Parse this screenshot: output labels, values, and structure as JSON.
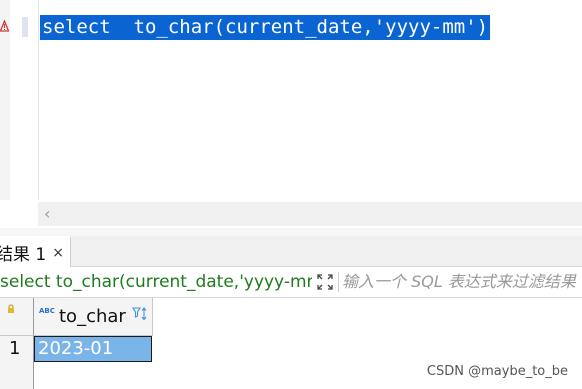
{
  "editor": {
    "code": "select  to_char(current_date,'yyyy-mm')",
    "warning_icon": "warning-triangle-icon",
    "hscroll_icon": "chevron-left-icon"
  },
  "results": {
    "tab_label": "结果 1",
    "tab_close": "×",
    "query_text": "select to_char(current_date,'yyyy-mm')",
    "filter_placeholder": "输入一个 SQL 表达式来过滤结果",
    "columns": [
      {
        "name": "to_char",
        "type_badge": "ABC"
      }
    ],
    "rows": [
      {
        "row_number": "1",
        "cells": [
          "2023-01"
        ]
      }
    ]
  },
  "watermark": "CSDN @maybe_to_be",
  "colors": {
    "selection": "#0a64d2",
    "selected_cell": "#7bb4e8",
    "query_text": "#1e7b1e"
  }
}
